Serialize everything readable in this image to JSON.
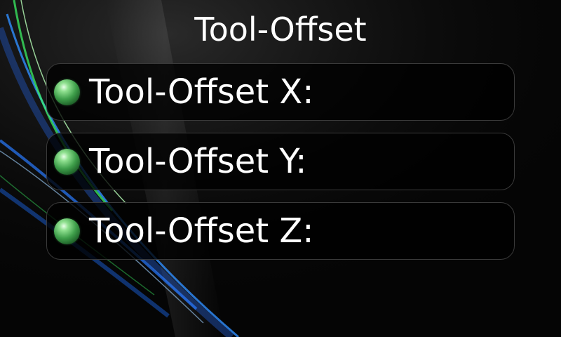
{
  "screen": {
    "title": "Tool-Offset"
  },
  "offsets": [
    {
      "label": "Tool-Offset X:",
      "indicator": "green-led-icon",
      "value": ""
    },
    {
      "label": "Tool-Offset Y:",
      "indicator": "green-led-icon",
      "value": ""
    },
    {
      "label": "Tool-Offset Z:",
      "indicator": "green-led-icon",
      "value": ""
    }
  ],
  "colors": {
    "background": "#050505",
    "text": "#ffffff",
    "indicator": "#3e9e4a",
    "row_border": "#3a3a3a"
  }
}
